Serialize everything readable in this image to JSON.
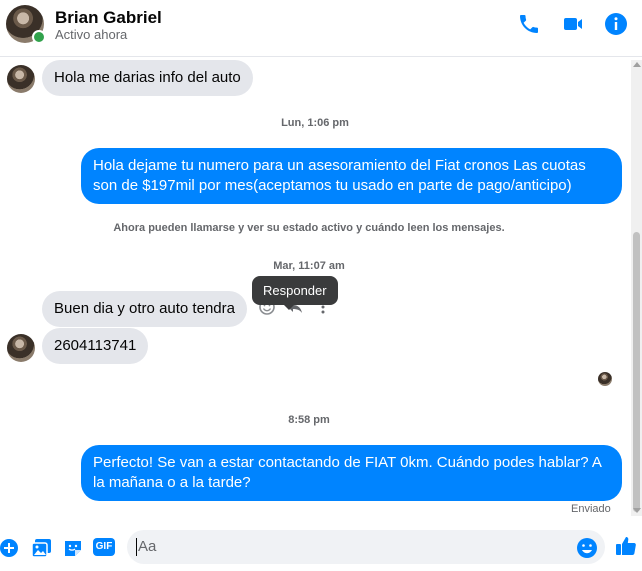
{
  "header": {
    "name": "Brian Gabriel",
    "status": "Activo ahora",
    "icons": [
      "phone-icon",
      "video-camera-icon",
      "info-icon"
    ]
  },
  "messages": [
    {
      "type": "incoming",
      "text": "Hola me darias info del auto"
    },
    {
      "type": "timestamp",
      "text": "Lun, 1:06 pm"
    },
    {
      "type": "outgoing",
      "text": "Hola dejame tu numero para un asesoramiento del Fiat cronos Las cuotas son de $197mil por mes(aceptamos tu usado en parte de pago/anticipo)"
    },
    {
      "type": "system",
      "text": "Ahora pueden llamarse y ver su estado activo y cuándo leen los mensajes."
    },
    {
      "type": "timestamp",
      "text": "Mar, 11:07 am"
    },
    {
      "type": "incoming",
      "text": "Buen dia y otro auto tendra"
    },
    {
      "type": "incoming",
      "text": "2604113741"
    },
    {
      "type": "timestamp",
      "text": "8:58 pm"
    },
    {
      "type": "outgoing",
      "text": "Perfecto!  Se van a estar contactando de FIAT 0km. Cuándo podes hablar? A la mañana o a la tarde?"
    }
  ],
  "tooltip": "Responder",
  "delivery_status": "Enviado",
  "composer": {
    "placeholder": "Aa",
    "gif_label": "GIF"
  },
  "colors": {
    "accent": "#0084ff",
    "incoming_bubble": "#e4e6eb",
    "online": "#31a24c"
  }
}
